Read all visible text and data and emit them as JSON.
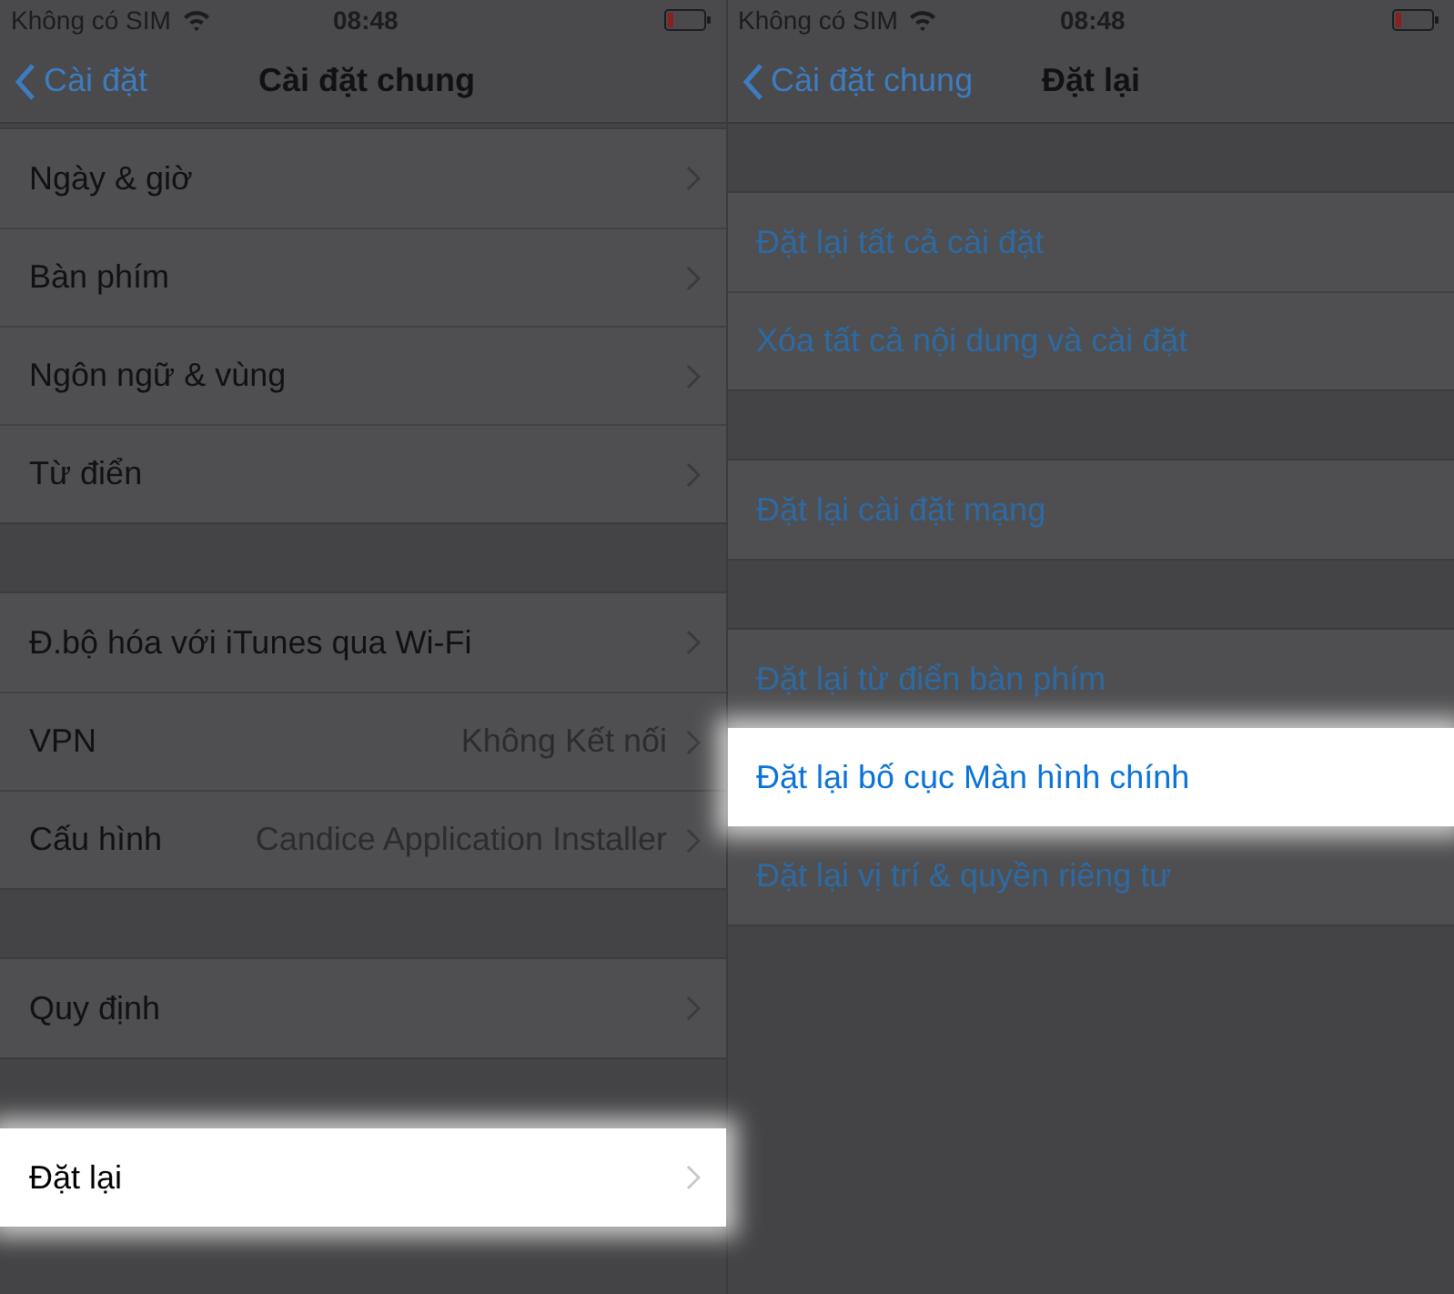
{
  "screens": [
    {
      "status_bar": {
        "carrier": "Không có SIM",
        "time": "08:48"
      },
      "nav": {
        "back": "Cài đặt",
        "title": "Cài đặt chung"
      },
      "groups": [
        {
          "rows": [
            {
              "kind": "disclosure",
              "label": "Ngày & giờ",
              "highlighted": false
            },
            {
              "kind": "disclosure",
              "label": "Bàn phím",
              "highlighted": false
            },
            {
              "kind": "disclosure",
              "label": "Ngôn ngữ & vùng",
              "highlighted": false
            },
            {
              "kind": "disclosure",
              "label": "Từ điển",
              "highlighted": false
            }
          ]
        },
        {
          "rows": [
            {
              "kind": "disclosure",
              "label": "Đ.bộ hóa với iTunes qua Wi-Fi",
              "highlighted": false
            },
            {
              "kind": "disclosure",
              "label": "VPN",
              "value": "Không Kết nối",
              "highlighted": false
            },
            {
              "kind": "disclosure",
              "label": "Cấu hình",
              "value": "Candice Application Installer",
              "highlighted": false
            }
          ]
        },
        {
          "rows": [
            {
              "kind": "disclosure",
              "label": "Quy định",
              "highlighted": false
            }
          ]
        },
        {
          "rows": [
            {
              "kind": "disclosure",
              "label": "Đặt lại",
              "highlighted": true
            }
          ]
        }
      ]
    },
    {
      "status_bar": {
        "carrier": "Không có SIM",
        "time": "08:48"
      },
      "nav": {
        "back": "Cài đặt chung",
        "title": "Đặt lại"
      },
      "groups": [
        {
          "rows": [
            {
              "kind": "action",
              "label": "Đặt lại tất cả cài đặt",
              "highlighted": false
            },
            {
              "kind": "action",
              "label": "Xóa tất cả nội dung và cài đặt",
              "highlighted": false
            }
          ]
        },
        {
          "rows": [
            {
              "kind": "action",
              "label": "Đặt lại cài đặt mạng",
              "highlighted": false
            }
          ]
        },
        {
          "rows": [
            {
              "kind": "action",
              "label": "Đặt lại từ điển bàn phím",
              "highlighted": false
            },
            {
              "kind": "action",
              "label": "Đặt lại bố cục Màn hình chính",
              "highlighted": true
            },
            {
              "kind": "action",
              "label": "Đặt lại vị trí & quyền riêng tư",
              "highlighted": false
            }
          ]
        }
      ]
    }
  ]
}
